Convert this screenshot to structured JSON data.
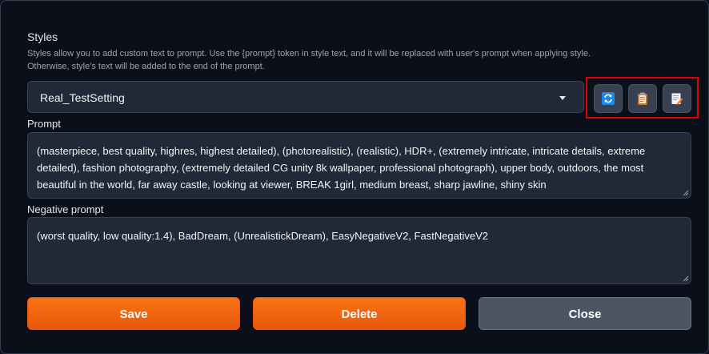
{
  "styles": {
    "title": "Styles",
    "description": "Styles allow you to add custom text to prompt. Use the {prompt} token in style text, and it will be replaced with user's prompt when applying style. Otherwise, style's text will be added to the end of the prompt.",
    "selected_style": "Real_TestSetting"
  },
  "tool_buttons": [
    {
      "icon": "refresh-icon"
    },
    {
      "icon": "clipboard-icon"
    },
    {
      "icon": "edit-icon"
    }
  ],
  "prompt": {
    "label": "Prompt",
    "value": "(masterpiece, best quality, highres, highest detailed), (photorealistic), (realistic), HDR+, (extremely intricate, intricate details, extreme detailed), fashion photography, (extremely detailed CG unity 8k wallpaper, professional photograph), upper body, outdoors, the most beautiful in the world, far away castle, looking at viewer, BREAK 1girl, medium breast, sharp jawline, shiny skin"
  },
  "negative_prompt": {
    "label": "Negative prompt",
    "value": "(worst quality, low quality:1.4), BadDream, (UnrealistickDream), EasyNegativeV2, FastNegativeV2"
  },
  "actions": {
    "save": "Save",
    "delete": "Delete",
    "close": "Close"
  },
  "colors": {
    "accent": "#f97316",
    "highlight_box": "#e00000",
    "background": "#0b0f19"
  }
}
